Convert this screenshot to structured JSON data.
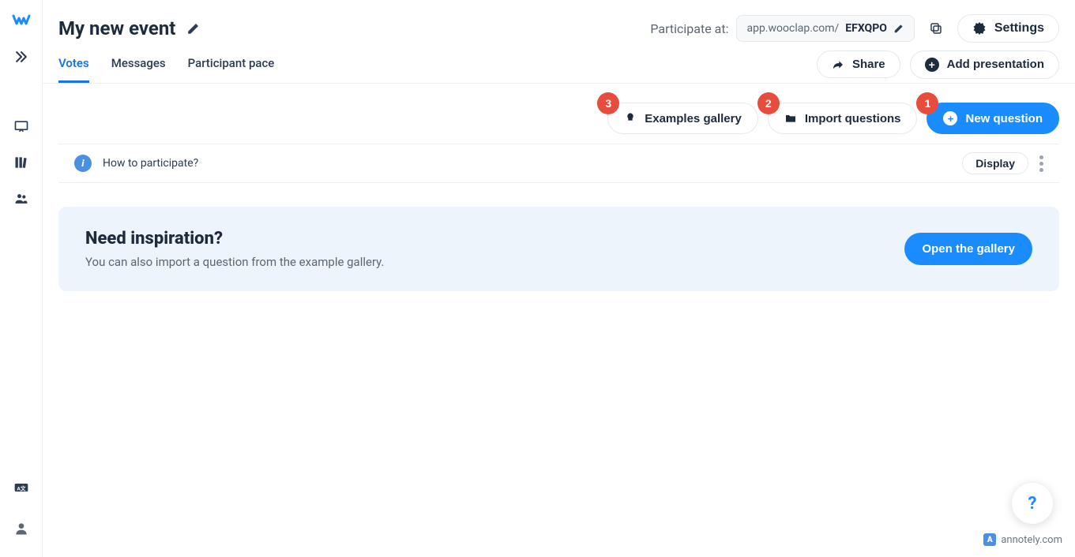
{
  "event_title": "My new event",
  "participate_label": "Participate at:",
  "url_prefix": "app.wooclap.com/",
  "url_code": "EFXQPO",
  "settings_label": "Settings",
  "tabs": {
    "votes": "Votes",
    "messages": "Messages",
    "participant_pace": "Participant pace"
  },
  "subheader_buttons": {
    "share": "Share",
    "add_presentation": "Add presentation"
  },
  "actions": {
    "examples_gallery": "Examples gallery",
    "import_questions": "Import questions",
    "new_question": "New question"
  },
  "badges": {
    "examples": "3",
    "import": "2",
    "new": "1"
  },
  "info": {
    "text": "How to participate?",
    "display_btn": "Display"
  },
  "inspiration": {
    "title": "Need inspiration?",
    "subtitle": "You can also import a question from the example gallery.",
    "btn": "Open the gallery"
  },
  "help": "?",
  "watermark": "annotely.com"
}
